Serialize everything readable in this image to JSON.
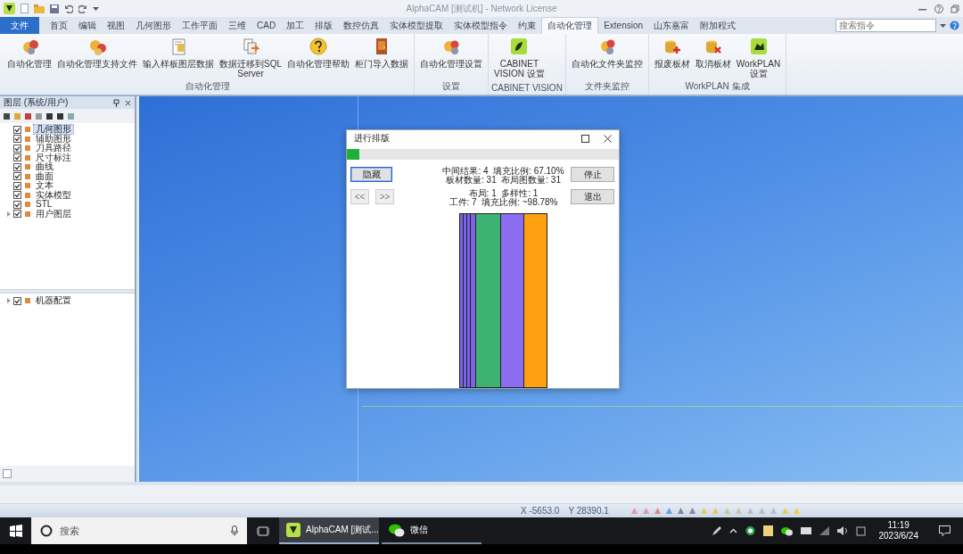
{
  "window": {
    "title": "AlphaCAM [测试机] - Network License"
  },
  "ribbon_tabs": [
    {
      "label": "文件",
      "kind": "file",
      "selected": false
    },
    {
      "label": "首页",
      "kind": "tab",
      "selected": false
    },
    {
      "label": "编辑",
      "kind": "tab",
      "selected": false
    },
    {
      "label": "视图",
      "kind": "tab",
      "selected": false
    },
    {
      "label": "几何图形",
      "kind": "tab",
      "selected": false
    },
    {
      "label": "工作平面",
      "kind": "tab",
      "selected": false
    },
    {
      "label": "三维",
      "kind": "tab",
      "selected": false
    },
    {
      "label": "CAD",
      "kind": "tab",
      "selected": false
    },
    {
      "label": "加工",
      "kind": "tab",
      "selected": false
    },
    {
      "label": "排版",
      "kind": "tab",
      "selected": false
    },
    {
      "label": "数控仿真",
      "kind": "tab",
      "selected": false
    },
    {
      "label": "实体模型提取",
      "kind": "tab",
      "selected": false
    },
    {
      "label": "实体模型指令",
      "kind": "tab",
      "selected": false
    },
    {
      "label": "约束",
      "kind": "tab",
      "selected": false
    },
    {
      "label": "自动化管理",
      "kind": "tab",
      "selected": true
    },
    {
      "label": "Extension",
      "kind": "tab",
      "selected": false
    },
    {
      "label": "山东嘉富",
      "kind": "tab",
      "selected": false
    },
    {
      "label": "附加程式",
      "kind": "tab",
      "selected": false
    }
  ],
  "search": {
    "placeholder": "搜索指令"
  },
  "ribbon_groups": [
    {
      "label": "自动化管理",
      "buttons": [
        "自动化管理",
        "自动化管理支持文件",
        "输入样板图层数据",
        "数据迁移到SQL\nServer",
        "自动化管理帮助",
        "柜门导入数据"
      ]
    },
    {
      "label": "设置",
      "buttons": [
        "自动化管理设置"
      ]
    },
    {
      "label": "CABINET VISION",
      "buttons": [
        "CABINET\nVISION 设置"
      ]
    },
    {
      "label": "文件夹监控",
      "buttons": [
        "自动化文件夹监控"
      ]
    },
    {
      "label": "WorkPLAN 集成",
      "buttons": [
        "报废板材",
        "取消板材",
        "WorkPLAN\n设置"
      ]
    }
  ],
  "layer_panel": {
    "title": "图层 (系统/用户)",
    "layers": [
      {
        "label": "几何图形",
        "checked": true,
        "selected": true
      },
      {
        "label": "辅助图形",
        "checked": true,
        "selected": false
      },
      {
        "label": "刀具路径",
        "checked": true,
        "selected": false
      },
      {
        "label": "尺寸标注",
        "checked": true,
        "selected": false
      },
      {
        "label": "曲线",
        "checked": true,
        "selected": false
      },
      {
        "label": "曲面",
        "checked": true,
        "selected": false
      },
      {
        "label": "文本",
        "checked": true,
        "selected": false
      },
      {
        "label": "实体模型",
        "checked": true,
        "selected": false
      },
      {
        "label": "STL",
        "checked": true,
        "selected": false
      },
      {
        "label": "用户图层",
        "checked": true,
        "selected": false
      }
    ],
    "machine_tree": [
      {
        "label": "机器配置",
        "checked": true,
        "selected": false
      }
    ]
  },
  "dialog": {
    "title": "进行排版",
    "progress": {
      "level": 0.045
    },
    "hide_button": "隐藏",
    "nav_buttons": [
      "<<",
      ">>"
    ],
    "action_buttons": [
      "停止",
      "退出"
    ],
    "stats": [
      [
        "中间结果: 4  填充比例: 67.10%",
        "板材数量: 31  布局图数量: 31"
      ],
      [
        "布局: 1  多样性: 1",
        "工件: 7  填充比例: ~98.78%"
      ]
    ]
  },
  "status_bar": {
    "x": "X -5653.0",
    "y": "Y 28390.1"
  },
  "taskbar": {
    "search_placeholder": "搜索",
    "apps": [
      {
        "label": "AlphaCAM [测试...",
        "kind": "alphacam",
        "selected": true
      },
      {
        "label": "微信",
        "kind": "wechat",
        "selected": false
      }
    ],
    "time": "11:19",
    "date": "2023/6/24"
  }
}
